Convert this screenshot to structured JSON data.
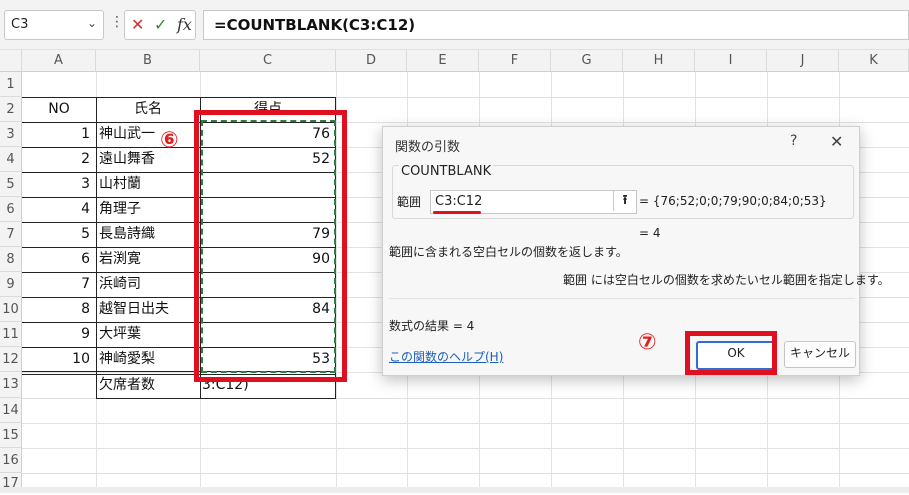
{
  "formula_bar": {
    "name_box": "C3",
    "name_box_dropdown": "⌄",
    "menu_dots": "⋮",
    "cancel_glyph": "✕",
    "enter_glyph": "✓",
    "fx_glyph": "fx",
    "formula": "=COUNTBLANK(C3:C12)"
  },
  "columns": [
    "A",
    "B",
    "C",
    "D",
    "E",
    "F",
    "G",
    "H",
    "I",
    "J",
    "K"
  ],
  "rows": [
    "1",
    "2",
    "3",
    "4",
    "5",
    "6",
    "7",
    "8",
    "9",
    "10",
    "11",
    "12",
    "13",
    "14",
    "15",
    "16",
    "17"
  ],
  "table": {
    "headers": {
      "no": "NO",
      "name": "氏名",
      "score": "得点"
    },
    "records": [
      {
        "no": "1",
        "name": "神山武一",
        "score": "76"
      },
      {
        "no": "2",
        "name": "遠山舞香",
        "score": "52"
      },
      {
        "no": "3",
        "name": "山村蘭",
        "score": ""
      },
      {
        "no": "4",
        "name": "角理子",
        "score": ""
      },
      {
        "no": "5",
        "name": "長島詩織",
        "score": "79"
      },
      {
        "no": "6",
        "name": "岩渕寛",
        "score": "90"
      },
      {
        "no": "7",
        "name": "浜崎司",
        "score": ""
      },
      {
        "no": "8",
        "name": "越智日出夫",
        "score": "84"
      },
      {
        "no": "9",
        "name": "大坪葉",
        "score": ""
      },
      {
        "no": "10",
        "name": "神崎愛梨",
        "score": "53"
      }
    ],
    "absent_label": "欠席者数",
    "absent_value": "3:C12)"
  },
  "annotations": {
    "step6": "⑥",
    "step7": "⑦"
  },
  "dialog": {
    "title": "関数の引数",
    "help_glyph": "?",
    "close_glyph": "✕",
    "function_name": "COUNTBLANK",
    "range_label": "範囲",
    "range_value": "C3:C12",
    "ref_button": "⭱",
    "range_result": "=  {76;52;0;0;79;90;0;84;0;53}",
    "result_eq": "=  4",
    "description": "範囲に含まれる空白セルの個数を返します。",
    "arg_description": "範囲   には空白セルの個数を求めたいセル範囲を指定します。",
    "formula_result": "数式の結果 =   4",
    "help_link": "この関数のヘルプ(H)",
    "ok_label": "OK",
    "cancel_label": "キャンセル"
  },
  "colors": {
    "highlight": "#e01020",
    "selection": "#2e7d44",
    "accent": "#2c6fd1"
  }
}
